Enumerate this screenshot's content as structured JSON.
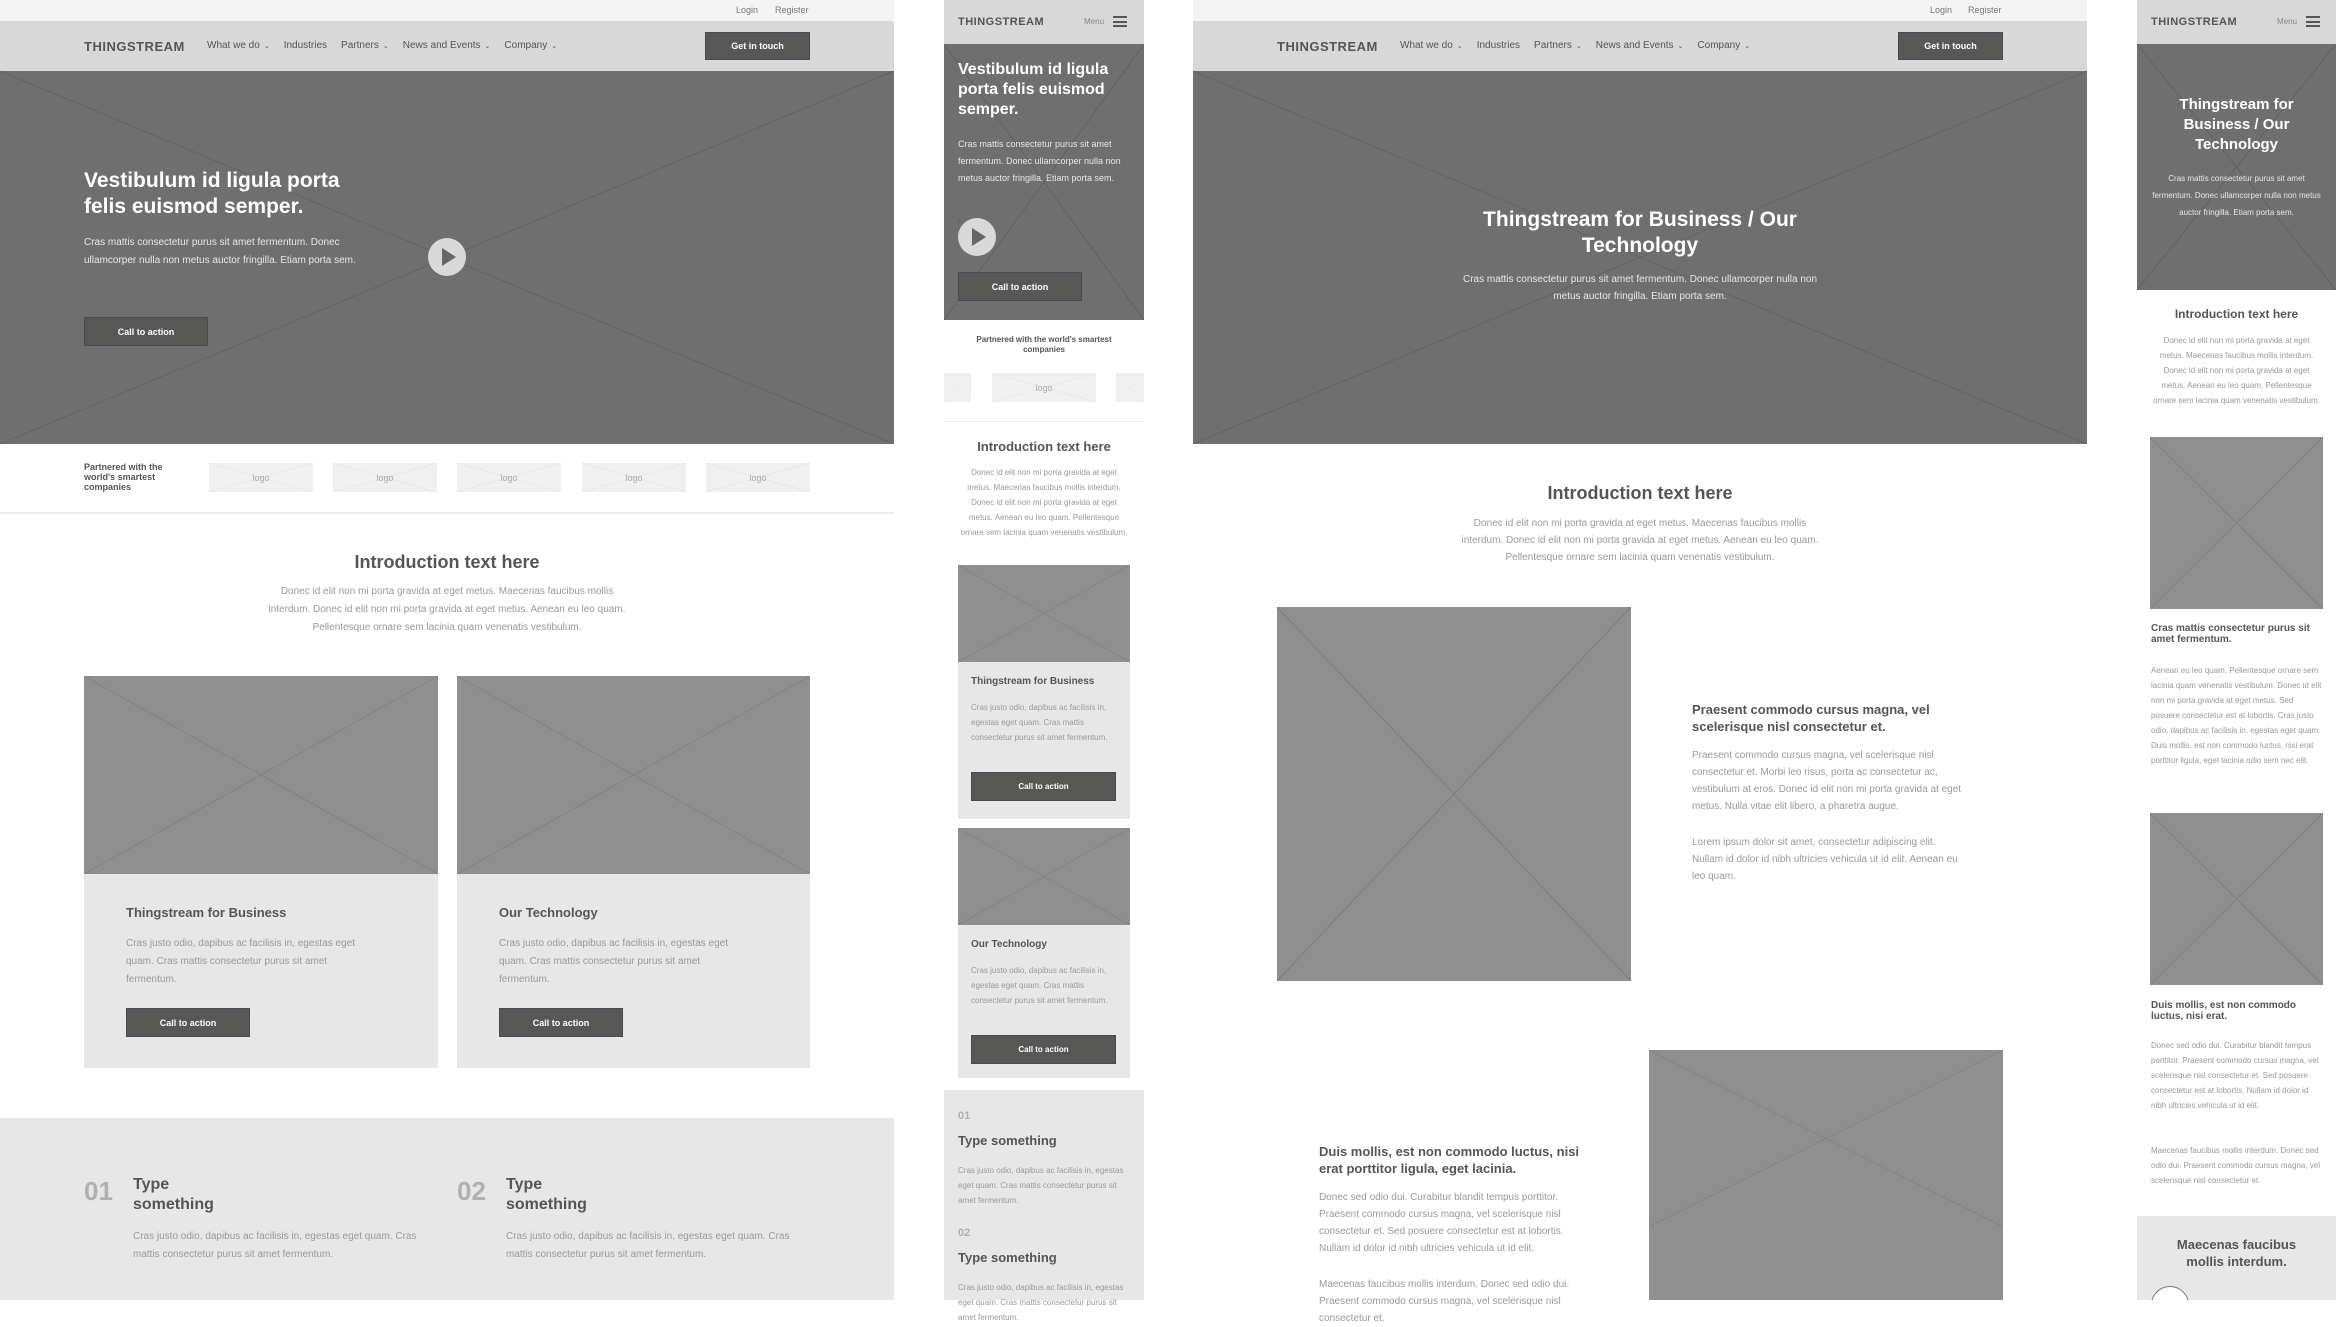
{
  "colors": {
    "hero": "#6f6f6f",
    "nav": "#d8d8d8",
    "topbar": "#f4f4f4",
    "card": "#e7e7e7",
    "placeholder": "#8f8f8f",
    "button": "#575756"
  },
  "brand": "THINGSTREAM",
  "topbar": {
    "login": "Login",
    "register": "Register"
  },
  "nav": {
    "items": [
      "What we do",
      "Industries",
      "Partners",
      "News and Events",
      "Company"
    ],
    "has_dropdown": [
      true,
      false,
      true,
      true,
      true
    ],
    "cta": "Get in touch",
    "menu_label": "Menu"
  },
  "home": {
    "hero": {
      "title": "Vestibulum id ligula porta felis euismod semper.",
      "body": "Cras mattis consectetur purus sit amet fermentum. Donec ullamcorper nulla non metus auctor fringilla. Etiam porta sem.",
      "cta": "Call to action"
    },
    "partners": {
      "label": "Partnered with the world's smartest companies",
      "logo": "logo"
    },
    "intro": {
      "title": "Introduction text here",
      "body": "Donec id elit non mi porta gravida at eget metus. Maecenas faucibus mollis interdum. Donec id elit non mi porta gravida at eget metus. Aenean eu leo quam. Pellentesque ornare sem lacinia quam venenatis vestibulum."
    },
    "cards": [
      {
        "title": "Thingstream for Business",
        "body": "Cras justo odio, dapibus ac facilisis in, egestas eget quam. Cras mattis consectetur purus sit amet fermentum.",
        "cta": "Call to action"
      },
      {
        "title": "Our Technology",
        "body": "Cras justo odio, dapibus ac facilisis in, egestas eget quam. Cras mattis consectetur purus sit amet fermentum.",
        "cta": "Call to action"
      }
    ],
    "steps": [
      {
        "num": "01",
        "title": "Type something",
        "body": "Cras justo odio, dapibus ac facilisis in, egestas eget quam. Cras mattis consectetur purus sit amet fermentum."
      },
      {
        "num": "02",
        "title": "Type something",
        "body": "Cras justo odio, dapibus ac facilisis in, egestas eget quam. Cras mattis consectetur purus sit amet fermentum."
      }
    ]
  },
  "product": {
    "hero": {
      "title": "Thingstream for Business / Our Technology",
      "body": "Cras mattis consectetur purus sit amet fermentum. Donec ullamcorper nulla non metus auctor fringilla. Etiam porta sem."
    },
    "intro": {
      "title": "Introduction text here",
      "body": "Donec id elit non mi porta gravida at eget metus. Maecenas faucibus mollis interdum. Donec id elit non mi porta gravida at eget metus. Aenean eu leo quam. Pellentesque ornare sem lacinia quam venenatis vestibulum."
    },
    "feature1": {
      "title": "Praesent commodo cursus magna, vel scelerisque nisl consectetur et.",
      "body1": "Praesent commodo cursus magna, vel scelerisque nisl consectetur et. Morbi leo risus, porta ac consectetur ac, vestibulum at eros. Donec id elit non mi porta gravida at eget metus. Nulla vitae elit libero, a pharetra augue.",
      "body2": "Lorem ipsum dolor sit amet, consectetur adipiscing elit. Nullam id dolor id nibh ultricies vehicula ut id elit. Aenean eu leo quam."
    },
    "feature2": {
      "title": "Duis mollis, est non commodo luctus, nisi erat porttitor ligula, eget lacinia.",
      "body1": "Donec sed odio dui. Curabitur blandit tempus porttitor. Praesent commodo cursus magna, vel scelerisque nisl consectetur et. Sed posuere consectetur est at lobortis. Nullam id dolor id nibh ultricies vehicula ut id elit.",
      "body2": "Maecenas faucibus mollis interdum. Donec sed odio dui. Praesent commodo cursus magna, vel scelerisque nisl consectetur et."
    }
  },
  "product_mobile": {
    "feature1": {
      "title": "Cras mattis consectetur purus sit amet fermentum.",
      "body": "Aenean eu leo quam. Pellentesque ornare sem lacinia quam venenatis vestibulum. Donec id elit non mi porta gravida at eget metus. Sed posuere consectetur est at lobortis. Cras justo odio, dapibus ac facilisis in, egestas eget quam. Duis mollis, est non commodo luctus, nisi erat porttitor ligula, eget lacinia odio sem nec elit."
    },
    "feature2": {
      "title": "Duis mollis, est non commodo luctus, nisi erat.",
      "body1": "Donec sed odio dui. Curabitur blandit tempus porttitor. Praesent commodo cursus magna, vel scelerisque nisl consectetur et. Sed posuere consectetur est at lobortis. Nullam id dolor id nibh ultricies vehicula ut id elit.",
      "body2": "Maecenas faucibus mollis interdum. Donec sed odio dui. Praesent commodo cursus magna, vel scelerisque nisl consectetur et."
    },
    "quote_title": "Maecenas faucibus mollis interdum."
  }
}
